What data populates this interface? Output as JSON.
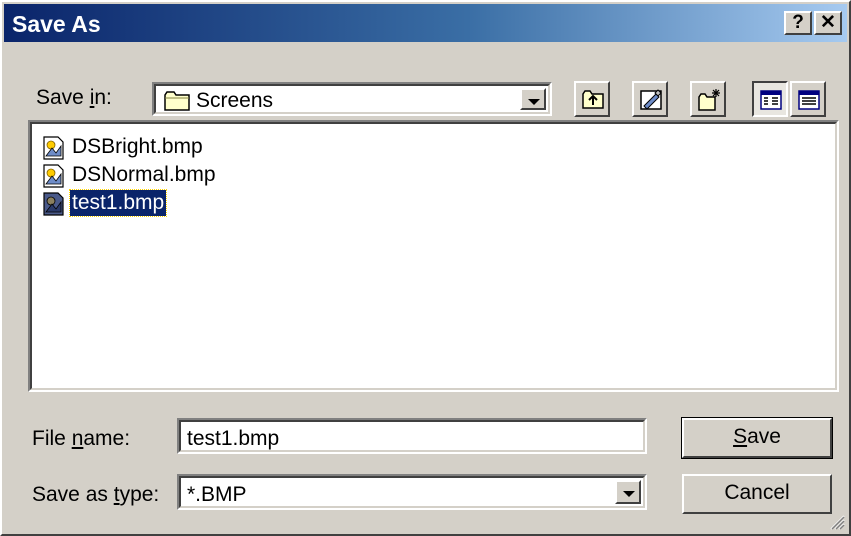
{
  "dialog": {
    "title": "Save As",
    "help_button_label": "?",
    "close_button_label": "✕"
  },
  "save_in": {
    "label_prefix": "Save ",
    "label_accel": "i",
    "label_suffix": "n:",
    "folder_value": "Screens",
    "folder_icon": "folder-icon"
  },
  "toolbar": {
    "buttons": [
      {
        "name": "up-one-level-button",
        "icon": "up-folder-icon"
      },
      {
        "name": "desktop-button",
        "icon": "desktop-icon"
      },
      {
        "name": "new-folder-button",
        "icon": "new-folder-icon"
      },
      {
        "name": "list-view-button",
        "icon": "list-view-icon",
        "pressed": true
      },
      {
        "name": "details-view-button",
        "icon": "details-view-icon",
        "pressed": false
      }
    ]
  },
  "files": [
    {
      "name": "DSBright.bmp",
      "icon": "bitmap-file-icon",
      "selected": false
    },
    {
      "name": "DSNormal.bmp",
      "icon": "bitmap-file-icon",
      "selected": false
    },
    {
      "name": "test1.bmp",
      "icon": "bitmap-file-icon",
      "selected": true
    }
  ],
  "file_name": {
    "label_prefix": "File ",
    "label_accel": "n",
    "label_suffix": "ame:",
    "value": "test1.bmp"
  },
  "save_as_type": {
    "label_prefix": "Save as ",
    "label_accel": "t",
    "label_suffix": "ype:",
    "value": "*.BMP"
  },
  "buttons": {
    "save_accel": "S",
    "save_rest": "ave",
    "cancel_label": "Cancel"
  },
  "colors": {
    "title_gradient_start": "#0a246a",
    "title_gradient_end": "#a6caf0",
    "selection": "#0a246a",
    "face": "#d4d0c8"
  }
}
